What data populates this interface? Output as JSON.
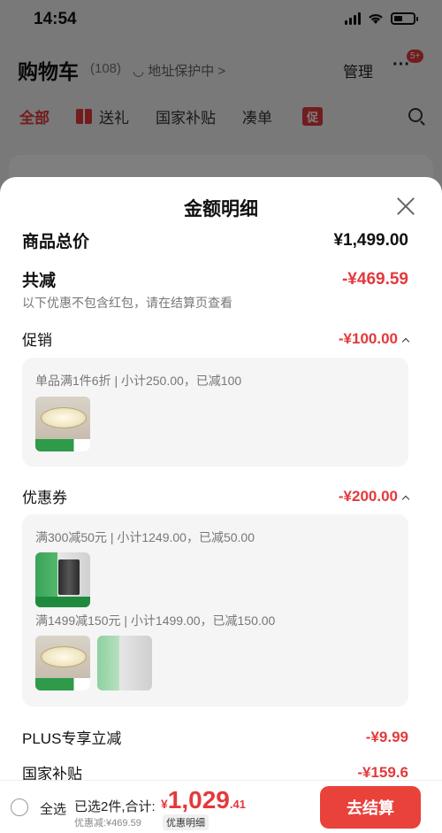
{
  "status_bar": {
    "time": "14:54"
  },
  "cart_header": {
    "title": "购物车",
    "count": "(108)",
    "address": "◡ 地址保护中 >",
    "manage": "管理",
    "more": "···",
    "badge": "5+"
  },
  "tabs": {
    "all": "全部",
    "gift": "送礼",
    "subsidy": "国家补贴",
    "combine": "凑单",
    "promo": "促"
  },
  "sheet": {
    "title": "金额明细",
    "goods_total_label": "商品总价",
    "goods_total_value": "¥1,499.00",
    "total_discount_label": "共减",
    "total_discount_value": "-¥469.59",
    "discount_note": "以下优惠不包含红包，请在结算页查看",
    "promotion_label": "促销",
    "promotion_value": "-¥100.00",
    "promotion_rule": "单品满1件6折 | 小计250.00，已减100",
    "coupon_label": "优惠券",
    "coupon_value": "-¥200.00",
    "coupon_rule_1": "满300减50元 | 小计1249.00，已减50.00",
    "coupon_rule_2": "满1499减150元 | 小计1499.00，已减150.00",
    "plus_label": "PLUS专享立减",
    "plus_value": "-¥9.99",
    "subsidy_label": "国家补贴",
    "subsidy_value": "-¥159.6"
  },
  "bottom_bar": {
    "select_all": "全选",
    "selected_info": "已选2件,合计:",
    "currency": "¥",
    "total_int": "1,029",
    "total_dec": ".41",
    "discount_line": "优惠减:¥469.59",
    "detail_link": "优惠明细",
    "checkout": "去结算"
  },
  "colors": {
    "accent": "#e4393c",
    "checkout": "#e8423b"
  }
}
